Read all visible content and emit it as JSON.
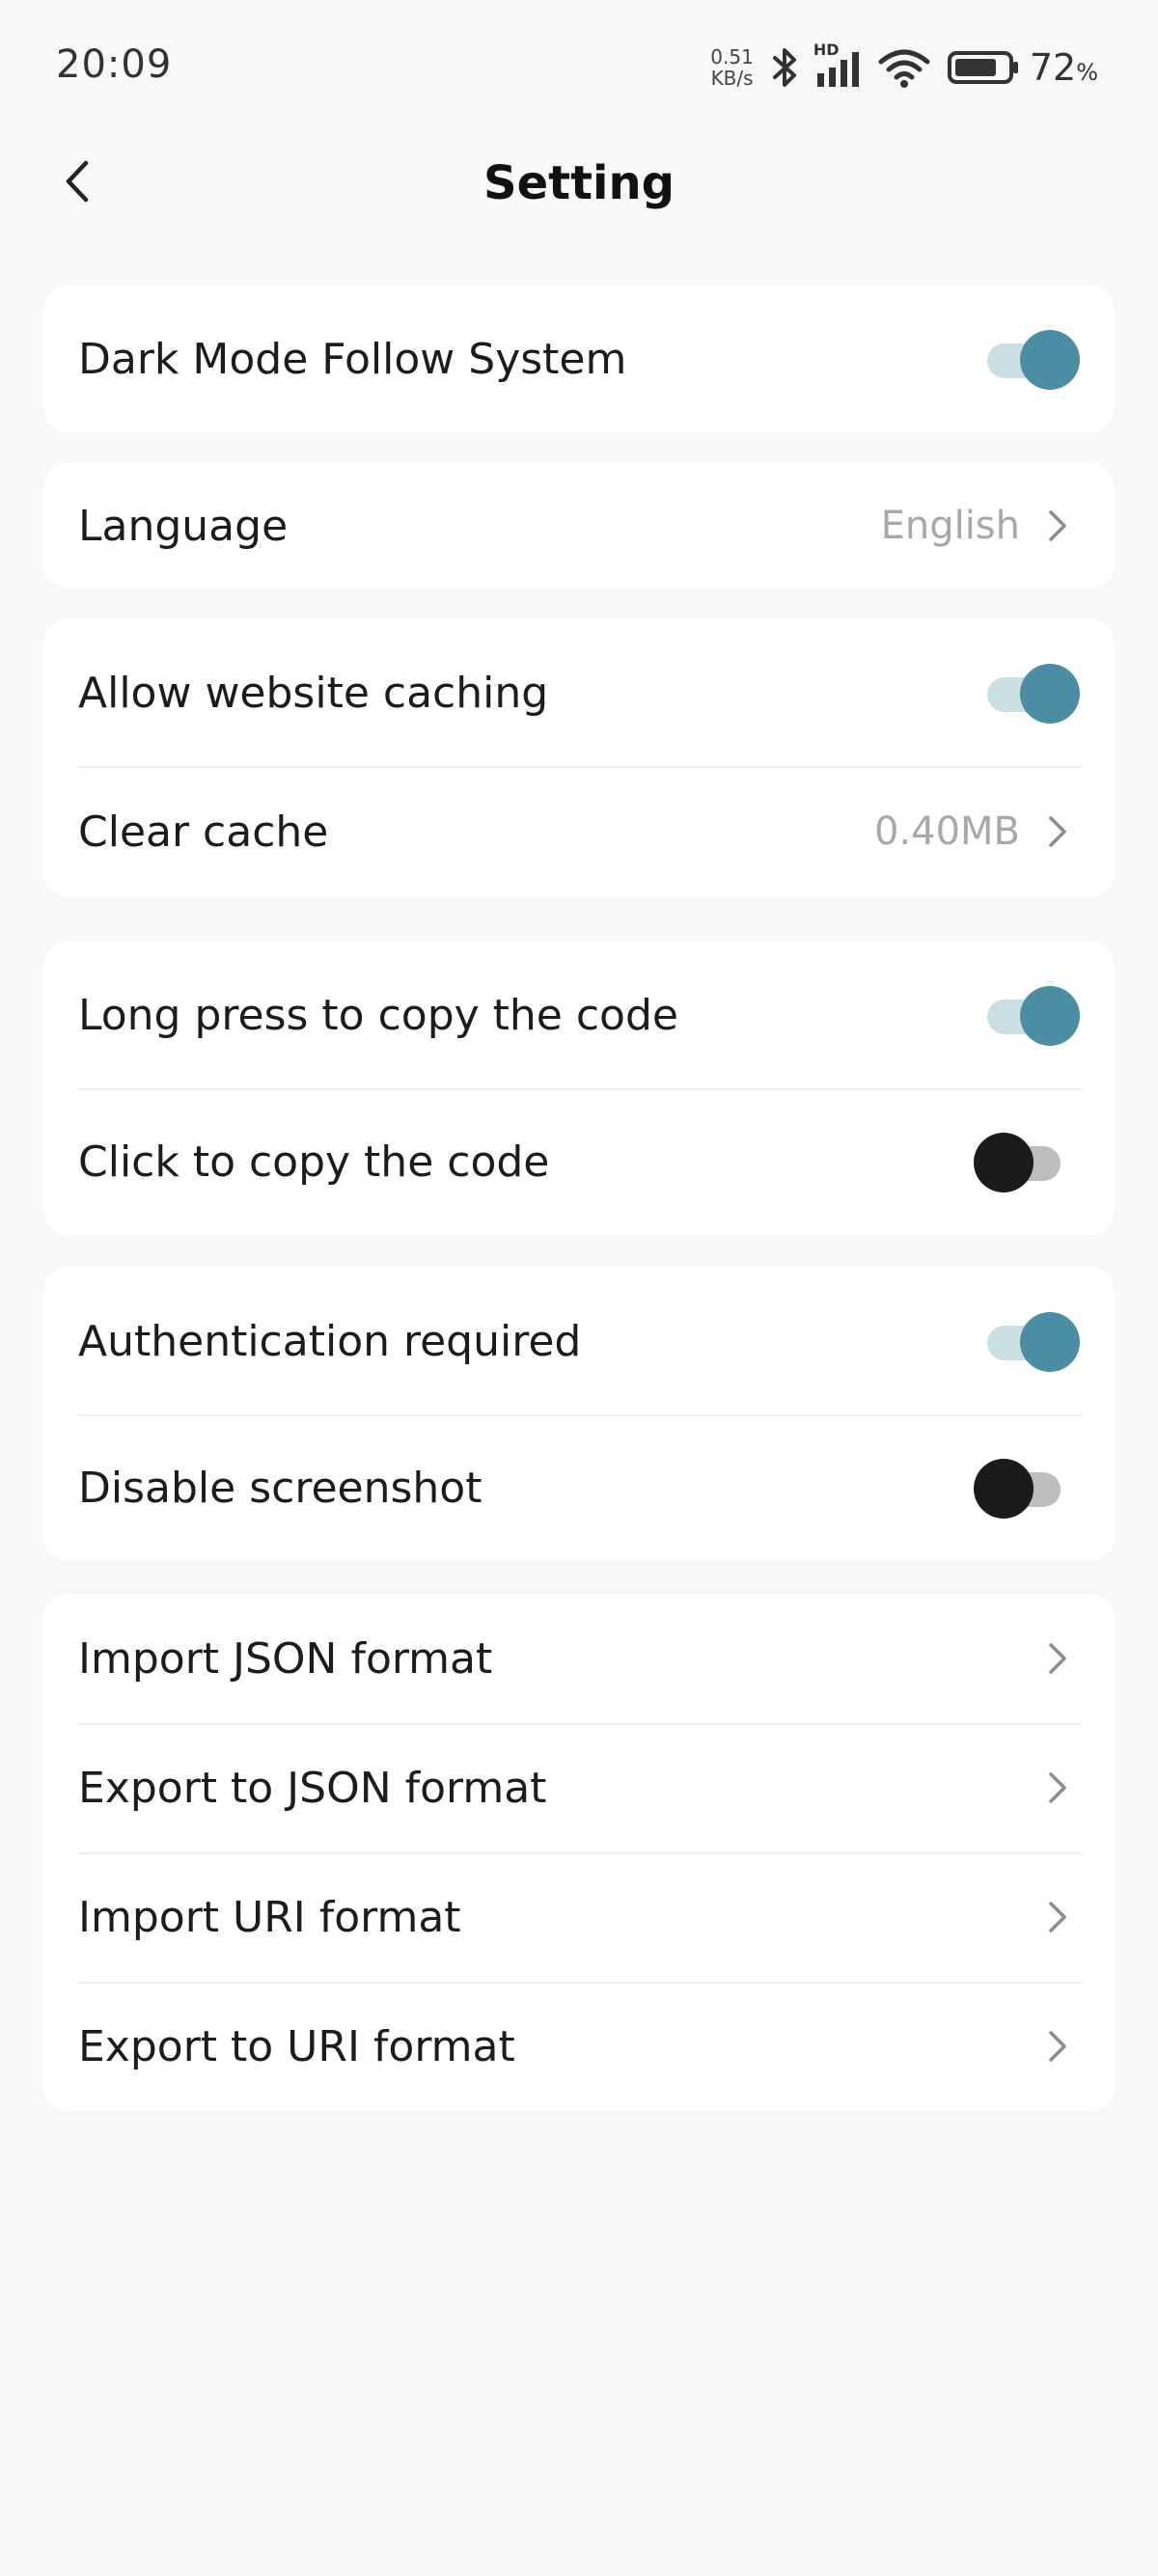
{
  "status_bar": {
    "time": "20:09",
    "net_speed_value": "0.51",
    "net_speed_unit": "KB/s",
    "hd_label": "HD",
    "battery_value": "72",
    "battery_unit": "%",
    "icons": [
      "bluetooth-icon",
      "signal-icon",
      "wifi-icon",
      "battery-icon"
    ]
  },
  "header": {
    "title": "Setting",
    "back_icon": "chevron-left-icon"
  },
  "settings": {
    "dark_mode": {
      "label": "Dark Mode Follow System",
      "enabled": true
    },
    "language": {
      "label": "Language",
      "value": "English"
    },
    "website_caching": {
      "label": "Allow website caching",
      "enabled": true
    },
    "clear_cache": {
      "label": "Clear cache",
      "value": "0.40MB"
    },
    "long_press_copy": {
      "label": "Long press to copy the code",
      "enabled": true
    },
    "click_copy": {
      "label": "Click to copy the code",
      "enabled": false
    },
    "authentication": {
      "label": "Authentication required",
      "enabled": true
    },
    "disable_screenshot": {
      "label": "Disable screenshot",
      "enabled": false
    },
    "import_json": {
      "label": "Import JSON format"
    },
    "export_json": {
      "label": "Export to JSON format"
    },
    "import_uri": {
      "label": "Import URI format"
    },
    "export_uri": {
      "label": "Export to URI format"
    }
  },
  "colors": {
    "background": "#f8f8f8",
    "card": "#ffffff",
    "accent": "#4b8ea3",
    "accent_track": "#c9dfe4",
    "off_knob": "#1b1b1b",
    "off_track": "#bdbdbd",
    "secondary_text": "#a8a8a8"
  }
}
